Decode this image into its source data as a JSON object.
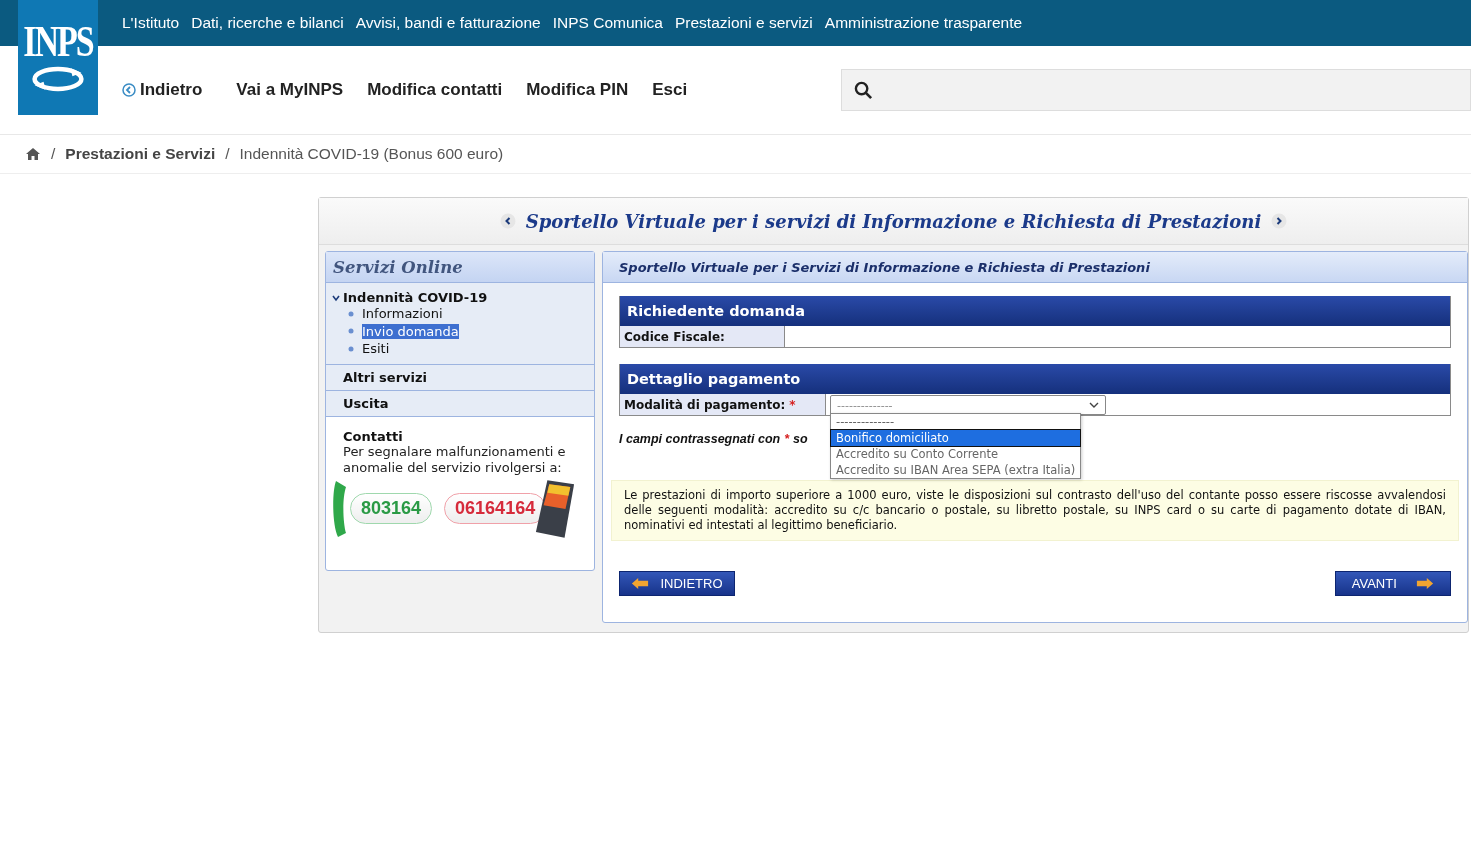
{
  "logo": {
    "text": "INPS"
  },
  "top_nav": [
    "L'Istituto",
    "Dati, ricerche e bilanci",
    "Avvisi, bandi e fatturazione",
    "INPS Comunica",
    "Prestazioni e servizi",
    "Amministrazione trasparente"
  ],
  "user_nav": [
    {
      "label": "Indietro",
      "kind": "back"
    },
    {
      "label": "Vai a MyINPS",
      "kind": "link"
    },
    {
      "label": "Modifica contatti",
      "kind": "link"
    },
    {
      "label": "Modifica PIN",
      "kind": "link"
    },
    {
      "label": "Esci",
      "kind": "link"
    }
  ],
  "breadcrumb": [
    {
      "separator": "/",
      "label": "Prestazioni e Servizi",
      "kind": "link"
    },
    {
      "separator": "/",
      "label": "Indennità COVID-19 (Bonus 600 euro)",
      "kind": "current"
    }
  ],
  "panel_title": "Sportello Virtuale per i servizi di Informazione e Richiesta di Prestazioni",
  "sidebar": {
    "title": "Servizi Online",
    "items": [
      {
        "label": "Indennità COVID-19",
        "expanded": true,
        "children": [
          {
            "label": "Informazioni",
            "selected": false
          },
          {
            "label": "Invio domanda",
            "selected": true
          },
          {
            "label": "Esiti",
            "selected": false
          }
        ]
      },
      {
        "label": "Altri servizi",
        "expanded": false
      },
      {
        "label": "Uscita",
        "expanded": false
      }
    ],
    "contacts": {
      "title": "Contatti",
      "text": "Per segnalare malfunzionamenti e anomalie del servizio rivolgersi a:",
      "landline": "803164",
      "mobile": "06164164"
    }
  },
  "content": {
    "title": "Sportello Virtuale per i Servizi di Informazione e Richiesta di Prestazioni",
    "sections": [
      {
        "title": "Richiedente domanda",
        "rows": [
          {
            "label": "Codice Fiscale:",
            "required": false,
            "kind": "text",
            "value": ""
          }
        ]
      },
      {
        "title": "Dettaglio pagamento",
        "rows": [
          {
            "label": "Modalità di pagamento:",
            "required": true,
            "kind": "select",
            "value": "--------------",
            "options": [
              {
                "label": "--------------",
                "highlighted": false
              },
              {
                "label": "Bonifico domiciliato",
                "highlighted": true
              },
              {
                "label": "Accredito su Conto Corrente",
                "highlighted": false
              },
              {
                "label": "Accredito su IBAN Area SEPA (extra Italia)",
                "highlighted": false
              }
            ]
          }
        ]
      }
    ],
    "required_note": {
      "before": "I campi contrassegnati con",
      "mark": "*",
      "after": "so"
    },
    "notice": "Le prestazioni di importo superiore a 1000 euro, viste le disposizioni sul contrasto dell'uso del contante posso essere riscosse avvalendosi delle seguenti modalità: accredito su c/c bancario o postale, su libretto postale, su INPS card o su carte di pagamento dotate di IBAN, nominativi ed intestati al legittimo beneficiario.",
    "buttons": [
      {
        "label": "INDIETRO",
        "kind": "back"
      },
      {
        "label": "AVANTI",
        "kind": "next"
      }
    ]
  }
}
